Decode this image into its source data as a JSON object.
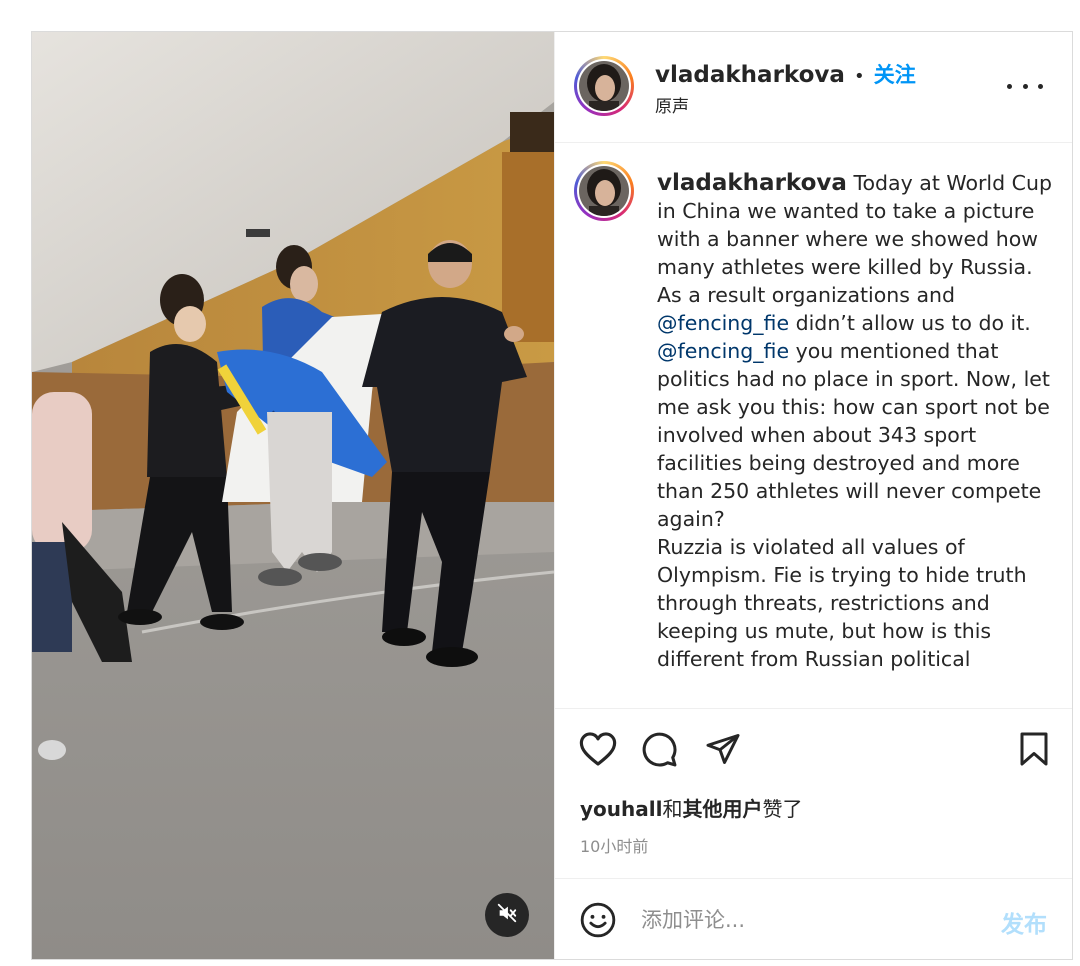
{
  "post": {
    "username": "vladakharkova",
    "separator": "•",
    "follow_label": "关注",
    "audio_label": "原声",
    "caption": {
      "username": "vladakharkova",
      "p1_a": "Today at World Cup in China we wanted to take a picture with a banner where we showed how many athletes were killed by Russia. As a result organizations and ",
      "mention1": "@fencing_fie",
      "p1_b": " didn’t allow us to do it.",
      "mention2": "@fencing_fie",
      "p2": " you mentioned that politics had no place in sport. Now, let me ask you this: how can sport not be involved when about 343 sport facilities being destroyed and more than 250 athletes will never compete again?",
      "p3": "Ruzzia is violated all values of Olympism. Fie is trying to hide truth through threats, restrictions and keeping us mute, but how is this different from Russian political"
    },
    "likes": {
      "user": "youhall",
      "joiner": "和",
      "others": "其他用户",
      "suffix": "赞了"
    },
    "time_ago": "10小时前",
    "comment": {
      "placeholder": "添加评论...",
      "post_label": "发布"
    }
  },
  "icons": {
    "more": "more-horizontal-icon",
    "like": "heart-icon",
    "comment": "comment-bubble-icon",
    "share": "paper-plane-icon",
    "save": "bookmark-icon",
    "emoji": "smiley-icon",
    "mute": "speaker-muted-icon"
  },
  "colors": {
    "accent": "#0095f6",
    "post_disabled": "#b2dffc",
    "muted_text": "#8e8e8e",
    "mention": "#00376b"
  }
}
